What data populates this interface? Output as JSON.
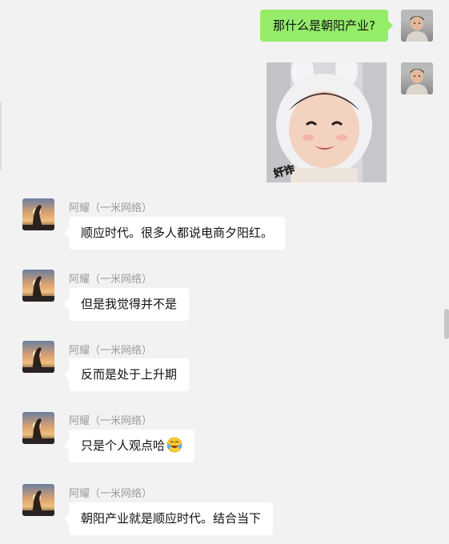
{
  "colors": {
    "background": "#f2f2f2",
    "outgoing_bubble": "#95ec69",
    "incoming_bubble": "#ffffff",
    "sender_name": "#9b9b9b"
  },
  "outgoing": [
    {
      "type": "text",
      "text": "那什么是朝阳产业?"
    },
    {
      "type": "sticker",
      "caption": "奸诈"
    }
  ],
  "incoming": [
    {
      "sender": "阿耀（一米网络）",
      "text": "顺应时代。很多人都说电商夕阳红。"
    },
    {
      "sender": "阿耀（一米网络）",
      "text": "但是我觉得并不是"
    },
    {
      "sender": "阿耀（一米网络）",
      "text": "反而是处于上升期"
    },
    {
      "sender": "阿耀（一米网络）",
      "text": "只是个人观点哈",
      "emoji": "laughing-with-tears-emoji"
    },
    {
      "sender": "阿耀（一米网络）",
      "text": "朝阳产业就是顺应时代。结合当下"
    }
  ]
}
